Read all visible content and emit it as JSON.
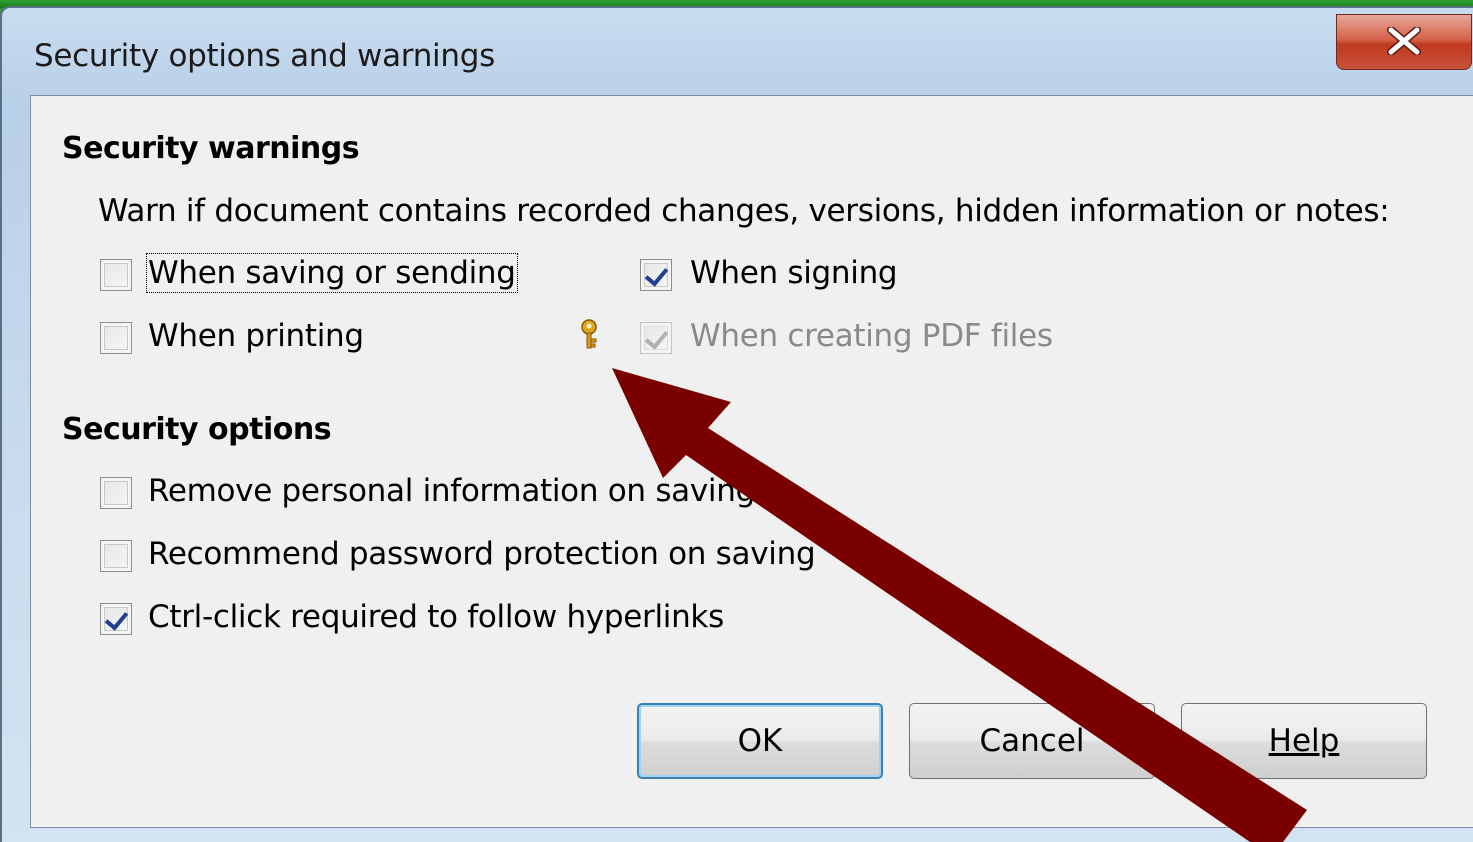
{
  "window": {
    "title": "Security options and warnings"
  },
  "security_warnings": {
    "heading": "Security warnings",
    "description": "Warn if document contains recorded changes, versions, hidden information or notes:",
    "options": [
      {
        "label": "When saving or sending",
        "checked": false,
        "enabled": true,
        "focused": true
      },
      {
        "label": "When signing",
        "checked": true,
        "enabled": true
      },
      {
        "label": "When printing",
        "checked": false,
        "enabled": true
      },
      {
        "label": "When creating PDF files",
        "checked": true,
        "enabled": false
      }
    ]
  },
  "security_options": {
    "heading": "Security options",
    "options": [
      {
        "label": "Remove personal information on saving",
        "checked": false
      },
      {
        "label": "Recommend password protection on saving",
        "checked": false
      },
      {
        "label": "Ctrl-click required to follow hyperlinks",
        "checked": true
      }
    ]
  },
  "buttons": {
    "ok": "OK",
    "cancel": "Cancel",
    "help": "Help"
  },
  "icons": {
    "lock_indicator": "key-icon",
    "close": "close-icon"
  },
  "colors": {
    "annotation_arrow": "#7a0000",
    "default_button_border": "#3c7fb1"
  }
}
